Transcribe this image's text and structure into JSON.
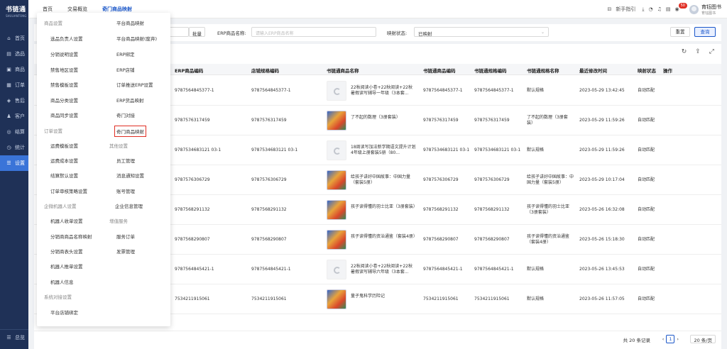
{
  "app": {
    "logo_title": "书链通",
    "logo_subtitle": "SHULIANTONG"
  },
  "nav": [
    {
      "icon": "home-icon",
      "glyph": "⌂",
      "label": "首页"
    },
    {
      "icon": "select-icon",
      "glyph": "▤",
      "label": "选品"
    },
    {
      "icon": "goods-icon",
      "glyph": "▣",
      "label": "商品"
    },
    {
      "icon": "order-icon",
      "glyph": "▦",
      "label": "订单"
    },
    {
      "icon": "aftersale-icon",
      "glyph": "◈",
      "label": "售后"
    },
    {
      "icon": "customer-icon",
      "glyph": "♟",
      "label": "客户"
    },
    {
      "icon": "settlement-icon",
      "glyph": "◎",
      "label": "结算"
    },
    {
      "icon": "stats-icon",
      "glyph": "◷",
      "label": "统计"
    },
    {
      "icon": "settings-icon",
      "glyph": "☰",
      "label": "设置"
    }
  ],
  "nav_bottom": {
    "label": "总览",
    "icon": "menu-icon"
  },
  "topbar": {
    "tabs": [
      "首页",
      "交易概览",
      "奇门商品映射"
    ],
    "guide": "新手指引",
    "badge": "50",
    "user_name": "育钰图书",
    "user_role": "育钰图书"
  },
  "filter": {
    "batch": "批量",
    "erp_name_label": "ERP商品名称:",
    "erp_name_placeholder": "请输入ERP商品名称",
    "map_state_label": "映射状态:",
    "map_state_value": "已映射",
    "reset": "重置",
    "query": "查询"
  },
  "table": {
    "headers": [
      "ERP商品编码",
      "店铺规格编码",
      "书链通商品名称",
      "书链通商品编码",
      "书链通规格编码",
      "书链通规格名称",
      "最近修改时间",
      "映射状态",
      "操作"
    ],
    "rows": [
      {
        "erp": "9787564845377-1",
        "shop": "9787564845377-1",
        "name": "22秋阅读小卷+22秋阅读+22秋暑假读写辅导一年级（3本套...",
        "slt": "9787564845377-1",
        "spec": "9787564845377-1",
        "spec_name": "默认规格",
        "time": "2023-05-29 13:42:45",
        "state": "自动匹配",
        "img": "placeholder",
        "acts": [
          "修改映射",
          "操作记录",
          "解除映射"
        ]
      },
      {
        "erp": "9787576317459",
        "shop": "9787576317459",
        "name": "了不起的数理（3册套装）",
        "slt": "9787576317459",
        "spec": "9787576317459",
        "spec_name": "了不起的数理（3册套装）",
        "time": "2023-05-29 11:59:26",
        "state": "自动匹配",
        "img": "cover",
        "acts": [
          "修改映射",
          "操作记录",
          "解除映射"
        ]
      },
      {
        "erp": "9787534683121 03-1",
        "shop": "9787534683121 03-1",
        "name": "18周读写加法新学期语文提升计划4年级上册套装5册（80...",
        "slt": "9787534683121 03-1",
        "spec": "9787534683121 03-1",
        "spec_name": "默认规格",
        "time": "2023-05-29 11:59:26",
        "state": "自动匹配",
        "img": "placeholder",
        "acts": [
          "修改映射",
          "操作记录",
          "解除映射"
        ]
      },
      {
        "erp": "9787576306729",
        "shop": "9787576306729",
        "name": "给孩子讲好中国故事：中国力量（套装5册）",
        "slt": "9787576306729",
        "spec": "9787576306729",
        "spec_name": "给孩子讲好中国故事：中国力量（套装5册）",
        "time": "2023-05-29 10:17:04",
        "state": "自动匹配",
        "img": "cover",
        "acts": [
          "修改映射",
          "操作记录",
          "解除映射"
        ]
      },
      {
        "erp": "9787568291132",
        "shop": "9787568291132",
        "name": "孩子读得懂的羽士比亚（3册套装）",
        "slt": "9787568291132",
        "spec": "9787568291132",
        "spec_name": "孩子读得懂的羽士比亚（3册套装）",
        "time": "2023-05-26 16:32:08",
        "state": "自动匹配",
        "img": "cover",
        "acts": [
          "修改映射",
          "操作记录",
          "解除映射"
        ]
      },
      {
        "erp": "9787568290807",
        "shop": "9787568290807",
        "name": "孩子读得懂的资治通鉴（套装4册）",
        "slt": "9787568290807",
        "spec": "9787568290807",
        "spec_name": "孩子读得懂的资治通鉴（套装4册）",
        "time": "2023-05-26 15:18:30",
        "state": "自动匹配",
        "img": "cover",
        "acts": [
          "修改映射",
          "操作记录",
          "解除映射"
        ]
      },
      {
        "erp": "9787564845421-1",
        "shop": "9787564845421-1",
        "name": "22秋阅读小卷+22秋阅读+22秋暑假读写辅导六年级（3本套...",
        "slt": "9787564845421-1",
        "spec": "9787564845421-1",
        "spec_name": "默认规格",
        "time": "2023-05-26 13:45:53",
        "state": "自动匹配",
        "img": "placeholder",
        "acts": [
          "修改映射",
          "操作记录",
          "解除映射"
        ]
      },
      {
        "erp": "7534211915061",
        "shop": "7534211915061",
        "name": "量子鬼科学历险记",
        "slt": "7534211915061",
        "spec": "7534211915061",
        "spec_name": "默认规格",
        "time": "2023-05-26 11:57:05",
        "state": "自动匹配",
        "img": "cover",
        "acts": [
          "修改映射",
          "操作记录"
        ]
      }
    ]
  },
  "footer": {
    "total": "共 20 条记录",
    "page": "1",
    "page_size": "20 条/页"
  },
  "menu": {
    "sections": [
      {
        "title": "商品设置",
        "items": [
          [
            "选品负责人设置",
            "平台商品映射"
          ],
          [
            "分销说明设置",
            "平台商品映射(废弃)"
          ],
          [
            "禁售地区设置",
            "ERP绑定"
          ],
          [
            "禁售模板设置",
            "ERP店铺"
          ],
          [
            "商品分类设置",
            "订单推送ERP设置"
          ],
          [
            "商品同步设置",
            "ERP货品映射"
          ],
          [
            "",
            "奇门对接"
          ],
          [
            "",
            "奇门商品映射"
          ]
        ]
      },
      {
        "title": "订单设置",
        "items": [
          [
            "运费模板设置",
            ""
          ],
          [
            "运费成本设置",
            "员工管理"
          ],
          [
            "结算默认设置",
            "消息通知设置"
          ],
          [
            "订单审核策略设置",
            "账号管理"
          ]
        ]
      },
      {
        "title": "企微机器人设置",
        "items": [
          [
            "机器人收单设置",
            ""
          ],
          [
            "分销商商品名称映射",
            "服务订单"
          ],
          [
            "分销商表头设置",
            "发票管理"
          ],
          [
            "机器人推单设置",
            ""
          ],
          [
            "机器人信息",
            ""
          ]
        ]
      },
      {
        "title": "系统对接设置",
        "items": [
          [
            "平台店铺绑定",
            ""
          ]
        ]
      }
    ],
    "right_headers": {
      "other": "其他设置",
      "value_added": "增值服务",
      "enterprise": "企业信息管理"
    }
  }
}
